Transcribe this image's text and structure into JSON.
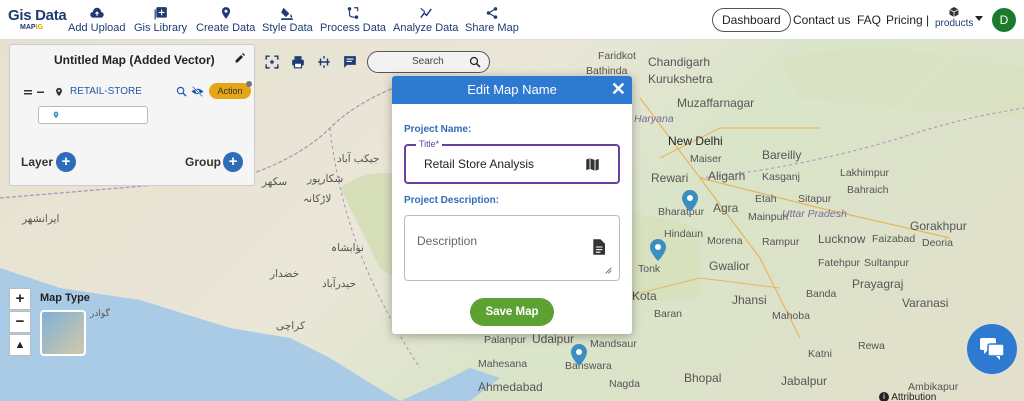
{
  "app": {
    "logo_line1": "Gis Data",
    "logo_line2a": "MAP",
    "logo_line2b": "IG"
  },
  "nav": [
    {
      "label": "Add Upload",
      "icon": "cloud-upload-icon"
    },
    {
      "label": "Gis Library",
      "icon": "library-add-icon"
    },
    {
      "label": "Create Data",
      "icon": "location-pin-icon"
    },
    {
      "label": "Style Data",
      "icon": "paint-bucket-icon"
    },
    {
      "label": "Process Data",
      "icon": "process-icon"
    },
    {
      "label": "Analyze Data",
      "icon": "analyze-icon"
    },
    {
      "label": "Share Map",
      "icon": "share-icon"
    }
  ],
  "topright": {
    "dashboard": "Dashboard",
    "contact": "Contact us",
    "faq": "FAQ",
    "pricing": "Pricing |",
    "products": "products",
    "avatar_initial": "D"
  },
  "panel": {
    "title": "Untitled Map (Added Vector)",
    "layer_name": "RETAIL-STORE",
    "action": "Action",
    "layer_label": "Layer",
    "group_label": "Group"
  },
  "toolbar": {
    "search_placeholder": "Search"
  },
  "maptype": {
    "label": "Map Type"
  },
  "modal": {
    "title": "Edit Map Name",
    "project_name_label": "Project Name:",
    "title_legend": "Title*",
    "title_value": "Retail Store Analysis",
    "project_desc_label": "Project Description:",
    "desc_placeholder": "Description",
    "save_label": "Save Map"
  },
  "attribution": "Attribution",
  "map_labels": {
    "faridkot": "Faridkot",
    "bathinda": "Bathinda",
    "chandigarh": "Chandigarh",
    "kurukshetra": "Kurukshetra",
    "muzaffarnagar": "Muzaffarnagar",
    "haryana": "Haryana",
    "newdelhi": "New Delhi",
    "bareilly": "Bareilly",
    "rewari": "Rewari",
    "aligarh": "Aligarh",
    "lakhimpur": "Lakhimpur",
    "bharatpur": "Bharatpur",
    "agra": "Agra",
    "mainpuri": "Mainpuri",
    "sitapur": "Sitapur",
    "bahraich": "Bahraich",
    "uttarpradesh": "Uttar Pradesh",
    "gorakhpur": "Gorakhpur",
    "morena": "Morena",
    "lucknow": "Lucknow",
    "faizabad": "Faizabad",
    "deoria": "Deoria",
    "gwalior": "Gwalior",
    "fatehpur": "Fatehpur",
    "sultanpur": "Sultanpur",
    "prayagraj": "Prayagraj",
    "jhansi": "Jhansi",
    "varanasi": "Varanasi",
    "banda": "Banda",
    "kota": "Kota",
    "baran": "Baran",
    "katni": "Katni",
    "rewa": "Rewa",
    "mandsaur": "Mandsaur",
    "mahesana": "Mahesana",
    "banswara": "Banswara",
    "ahmedabad": "Ahmedabad",
    "nagda": "Nagda",
    "bhopal": "Bhopal",
    "jabalpur": "Jabalpur",
    "ambikapur": "Ambikapur",
    "palanpur": "Palanpur",
    "udaipur": "Udaipur",
    "tonk": "Tonk",
    "hindaun": "Hindaun",
    "mahoba": "Mahoba",
    "maiser": "Maiser",
    "kasganj": "Kasganj",
    "etah": "Etah",
    "rampur": "Rampur",
    "urdu1": "جيكب آباد",
    "urdu2": "شکارپور",
    "urdu3": "لاڑکانہ",
    "urdu4": "نوابشاہ",
    "urdu5": "حیدرآباد",
    "urdu6": "کراچی",
    "urdu7": "ایرانشهر",
    "urdu8": "خضدار",
    "urdu9": "سکھر",
    "urdu10": "گوادر"
  }
}
